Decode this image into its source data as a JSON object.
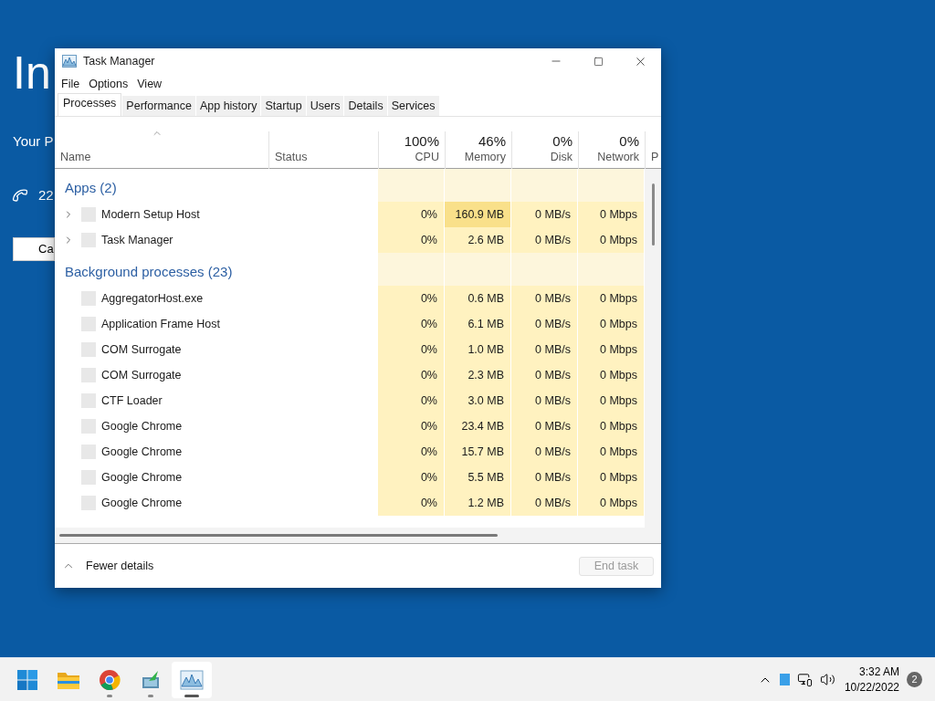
{
  "desktop": {
    "heading": "In",
    "subtitle": "Your P",
    "phone_text": "22",
    "button": "Ca"
  },
  "window": {
    "title": "Task Manager"
  },
  "menu": [
    "File",
    "Options",
    "View"
  ],
  "tabs": [
    {
      "label": "Processes",
      "selected": true
    },
    {
      "label": "Performance",
      "selected": false
    },
    {
      "label": "App history",
      "selected": false
    },
    {
      "label": "Startup",
      "selected": false
    },
    {
      "label": "Users",
      "selected": false
    },
    {
      "label": "Details",
      "selected": false
    },
    {
      "label": "Services",
      "selected": false
    }
  ],
  "columns": [
    {
      "label": "Name",
      "kind": "text"
    },
    {
      "label": "Status",
      "kind": "text"
    },
    {
      "label": "CPU",
      "total": "100%",
      "kind": "metric"
    },
    {
      "label": "Memory",
      "total": "46%",
      "kind": "metric"
    },
    {
      "label": "Disk",
      "total": "0%",
      "kind": "metric"
    },
    {
      "label": "Network",
      "total": "0%",
      "kind": "metric"
    },
    {
      "label": "P",
      "kind": "text"
    }
  ],
  "groups": [
    {
      "title": "Apps (2)",
      "rows": [
        {
          "name": "Modern Setup Host",
          "expanded": false,
          "cpu": "0%",
          "memory": "160.9 MB",
          "memory_heavy": true,
          "disk": "0 MB/s",
          "network": "0 Mbps"
        },
        {
          "name": "Task Manager",
          "expanded": false,
          "cpu": "0%",
          "memory": "2.6 MB",
          "memory_heavy": false,
          "disk": "0 MB/s",
          "network": "0 Mbps"
        }
      ]
    },
    {
      "title": "Background processes (23)",
      "rows": [
        {
          "name": "AggregatorHost.exe",
          "cpu": "0%",
          "memory": "0.6 MB",
          "memory_heavy": false,
          "disk": "0 MB/s",
          "network": "0 Mbps"
        },
        {
          "name": "Application Frame Host",
          "cpu": "0%",
          "memory": "6.1 MB",
          "memory_heavy": false,
          "disk": "0 MB/s",
          "network": "0 Mbps"
        },
        {
          "name": "COM Surrogate",
          "cpu": "0%",
          "memory": "1.0 MB",
          "memory_heavy": false,
          "disk": "0 MB/s",
          "network": "0 Mbps"
        },
        {
          "name": "COM Surrogate",
          "cpu": "0%",
          "memory": "2.3 MB",
          "memory_heavy": false,
          "disk": "0 MB/s",
          "network": "0 Mbps"
        },
        {
          "name": "CTF Loader",
          "cpu": "0%",
          "memory": "3.0 MB",
          "memory_heavy": false,
          "disk": "0 MB/s",
          "network": "0 Mbps"
        },
        {
          "name": "Google Chrome",
          "cpu": "0%",
          "memory": "23.4 MB",
          "memory_heavy": false,
          "disk": "0 MB/s",
          "network": "0 Mbps"
        },
        {
          "name": "Google Chrome",
          "cpu": "0%",
          "memory": "15.7 MB",
          "memory_heavy": false,
          "disk": "0 MB/s",
          "network": "0 Mbps"
        },
        {
          "name": "Google Chrome",
          "cpu": "0%",
          "memory": "5.5 MB",
          "memory_heavy": false,
          "disk": "0 MB/s",
          "network": "0 Mbps"
        },
        {
          "name": "Google Chrome",
          "cpu": "0%",
          "memory": "1.2 MB",
          "memory_heavy": false,
          "disk": "0 MB/s",
          "network": "0 Mbps"
        }
      ]
    }
  ],
  "footer": {
    "details_label": "Fewer details",
    "end_task": {
      "label": "End task",
      "disabled": true
    }
  },
  "taskbar": {
    "apps": [
      {
        "kind": "start",
        "running": false,
        "active": false
      },
      {
        "kind": "folder",
        "running": false,
        "active": false
      },
      {
        "kind": "browser",
        "running": true,
        "active": false
      },
      {
        "kind": "installer",
        "running": true,
        "active": false
      },
      {
        "kind": "monitor",
        "running": true,
        "active": true
      }
    ],
    "time": "3:32 AM",
    "date": "10/22/2022",
    "notifications": "2"
  }
}
